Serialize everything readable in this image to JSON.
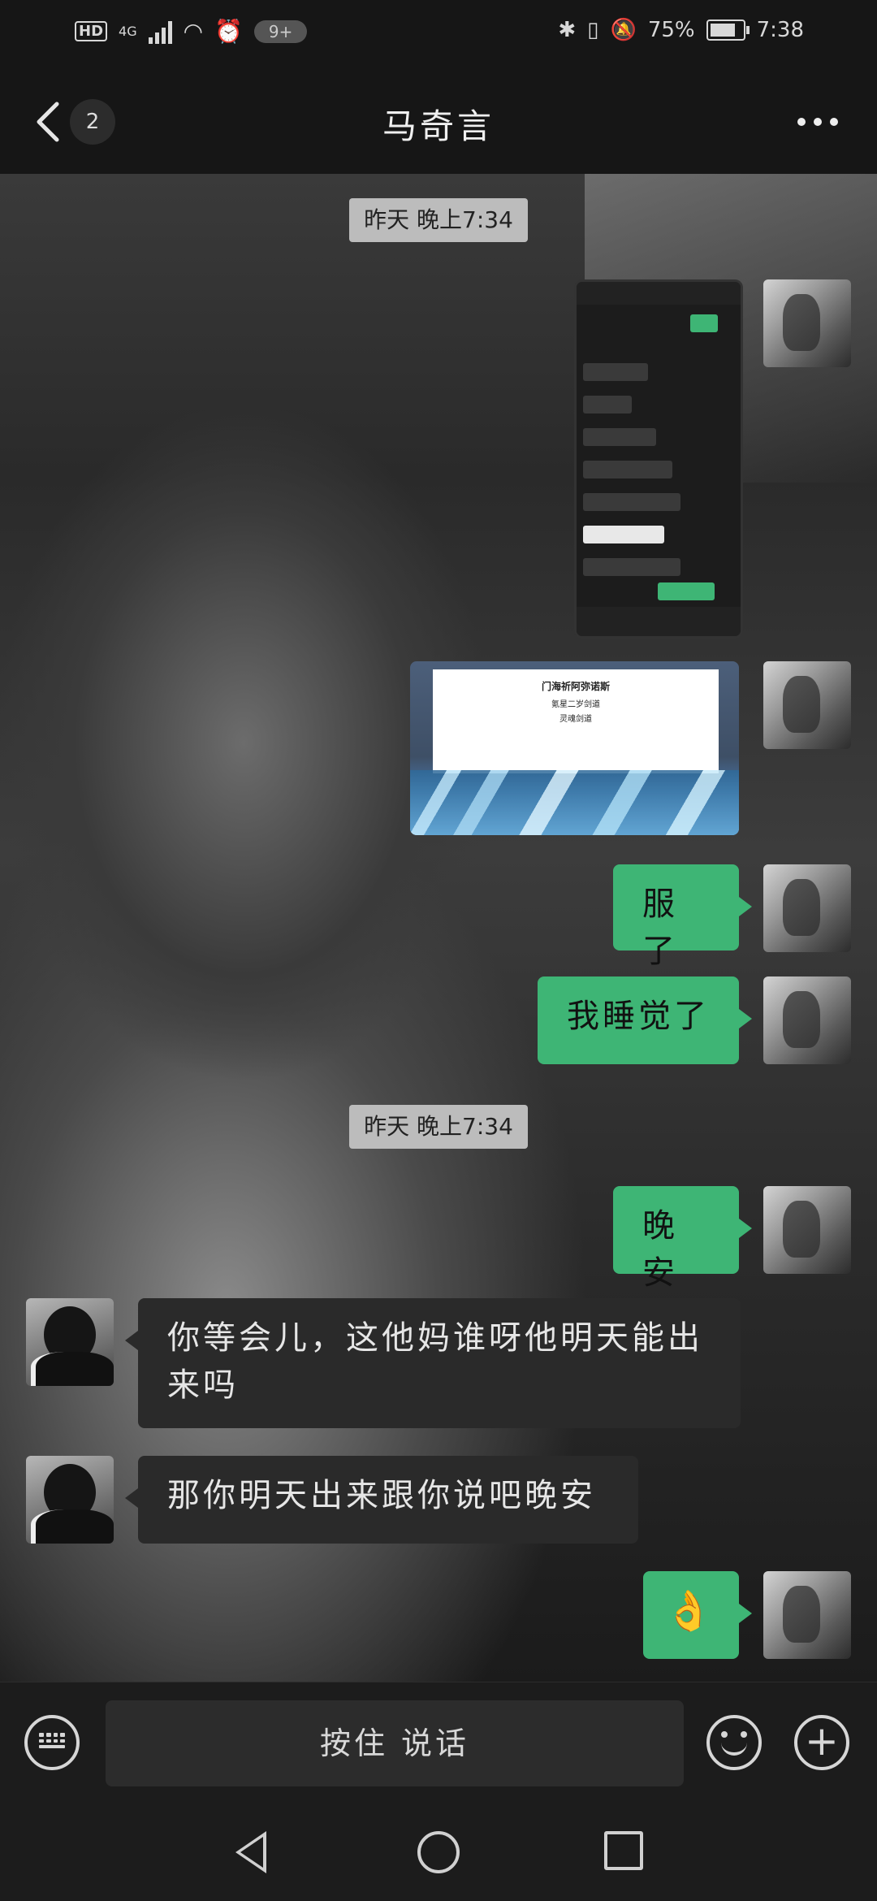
{
  "status_bar": {
    "hd": "HD",
    "network": "4G",
    "notifications": "9+",
    "battery": "75%",
    "time": "7:38"
  },
  "header": {
    "back_count": "2",
    "title": "马奇言"
  },
  "messages": {
    "timestamp_1": "昨天 晚上7:34",
    "timestamp_2": "昨天 晚上7:34",
    "m1": "服了",
    "m2": "我睡觉了",
    "m3": "晚安",
    "m4": "你等会儿，这他妈谁呀他明天能出来吗",
    "m5": "那你明天出来跟你说吧晚安",
    "m6": "👌"
  },
  "image_doc": {
    "title": "门海祈阿弥诺斯",
    "line1": "氪星二岁剑道",
    "line2": "灵魂剑道"
  },
  "input": {
    "hold_to_talk": "按住 说话"
  }
}
